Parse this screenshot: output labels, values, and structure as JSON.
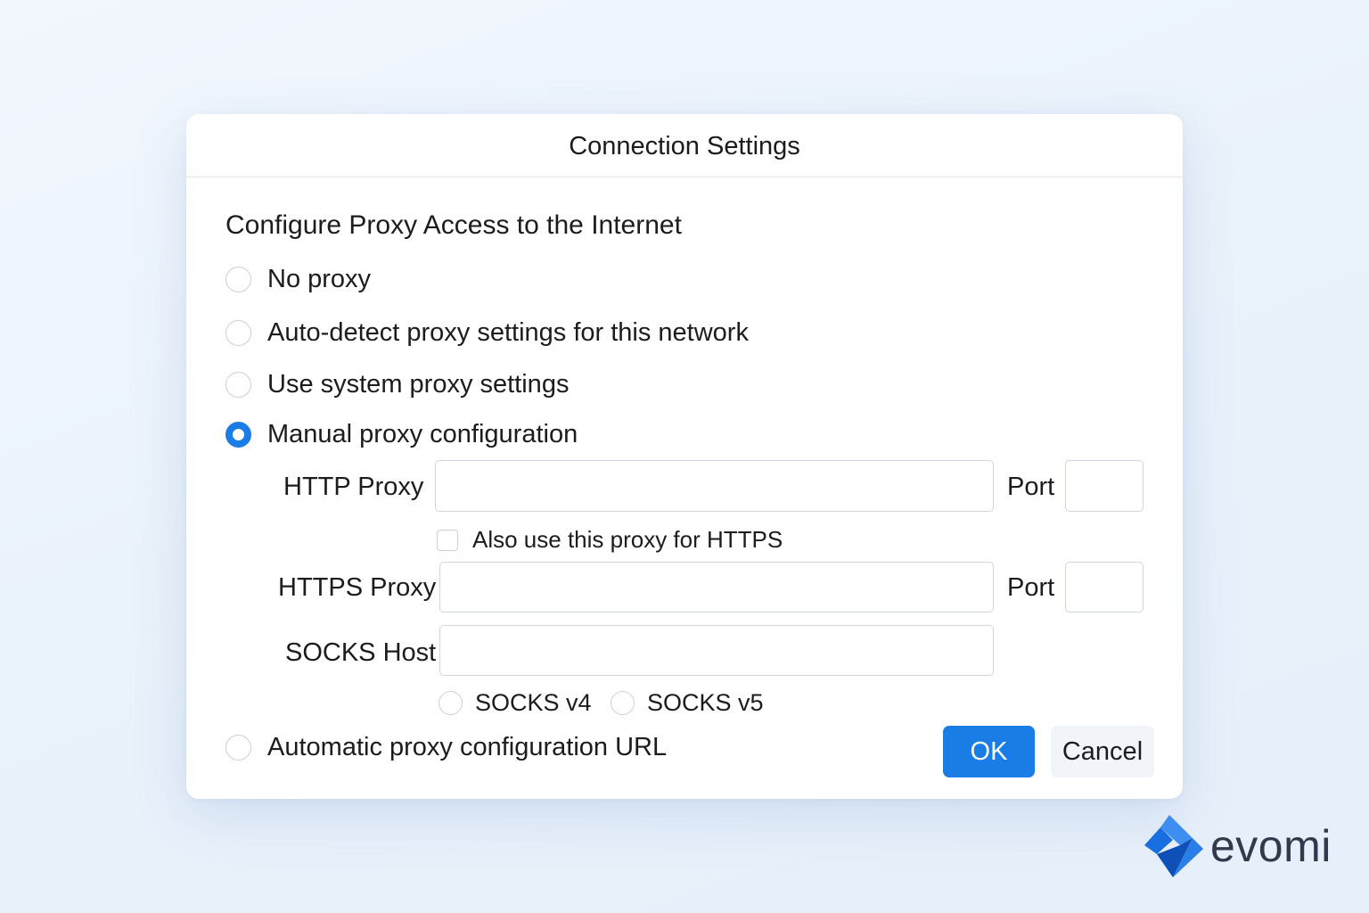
{
  "dialog": {
    "title": "Connection Settings",
    "heading": "Configure Proxy Access to the Internet",
    "options": [
      {
        "label": "No proxy",
        "selected": false
      },
      {
        "label": "Auto-detect proxy settings for this network",
        "selected": false
      },
      {
        "label": "Use system proxy settings",
        "selected": false
      },
      {
        "label": "Manual proxy configuration",
        "selected": true
      },
      {
        "label": "Automatic proxy configuration URL",
        "selected": false
      }
    ],
    "manual": {
      "http_label": "HTTP Proxy",
      "http_value": "",
      "http_port_label": "Port",
      "http_port_value": "",
      "also_https_label": "Also use this proxy for HTTPS",
      "also_https_checked": false,
      "https_label": "HTTPS Proxy",
      "https_value": "",
      "https_port_label": "Port",
      "https_port_value": "",
      "socks_label": "SOCKS Host",
      "socks_value": "",
      "socks_v4_label": "SOCKS v4",
      "socks_v5_label": "SOCKS v5"
    },
    "buttons": {
      "ok": "OK",
      "cancel": "Cancel"
    }
  },
  "brand": {
    "name": "evomi",
    "logo_icon": "evomi-logo-icon",
    "logo_colors": [
      "#1a6fe0",
      "#3d8ef0",
      "#0f4fb8"
    ]
  },
  "colors": {
    "accent": "#1a7de6",
    "background": "#eaf2fb"
  }
}
